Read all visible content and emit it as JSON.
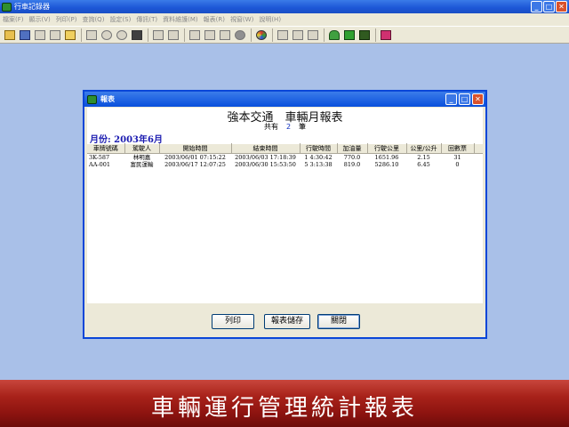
{
  "app": {
    "title": "行車記錄器",
    "window_buttons": {
      "minimize": "_",
      "maximize": "□",
      "close": "✕"
    }
  },
  "menu": [
    "檔案(F)",
    "顯示(V)",
    "列印(P)",
    "查詢(Q)",
    "設定(S)",
    "傳訊(T)",
    "資料維護(M)",
    "報表(R)",
    "視窗(W)",
    "說明(H)"
  ],
  "toolbar": {
    "icons": [
      "open-folder-icon",
      "disk-icon",
      "stop-icon",
      "delete-icon",
      "run-icon",
      "table-icon",
      "zoom-in-icon",
      "zoom-out-icon",
      "binoculars-icon",
      "print-icon",
      "print-preview-icon",
      "page-icon",
      "card-icon",
      "frame-icon",
      "record-icon",
      "color-icon",
      "chart-icon",
      "list-icon",
      "column-icon",
      "users-icon",
      "car-icon",
      "book-icon",
      "eraser-icon"
    ]
  },
  "dialog": {
    "title": "報表",
    "report_title": "強本交通　車輛月報表",
    "count_label": "共有",
    "count_value": "2",
    "count_unit": "筆",
    "month": "月份: 2003年6月",
    "columns": [
      "車牌號碼",
      "駕駛人",
      "開始時間",
      "結束時間",
      "行駛時間",
      "加油量",
      "行駛公里",
      "公里/公升",
      "回數票",
      ""
    ],
    "rows": [
      [
        "3K-587",
        "林明嘉",
        "2003/06/01 07:15:22",
        "2003/06/03 17:18:39",
        "1 4:30:42",
        "770.0",
        "1651.96",
        "2.15",
        "31",
        ""
      ],
      [
        "AA-001",
        "富民運輸",
        "2003/06/17 12:07:25",
        "2003/06/30 15:53:50",
        "5 3:13:38",
        "819.0",
        "5286.10",
        "6.45",
        "0",
        ""
      ]
    ],
    "buttons": {
      "print": "列印",
      "save": "報表儲存",
      "close": "關閉"
    }
  },
  "banner": {
    "text": "車輛運行管理統計報表"
  }
}
